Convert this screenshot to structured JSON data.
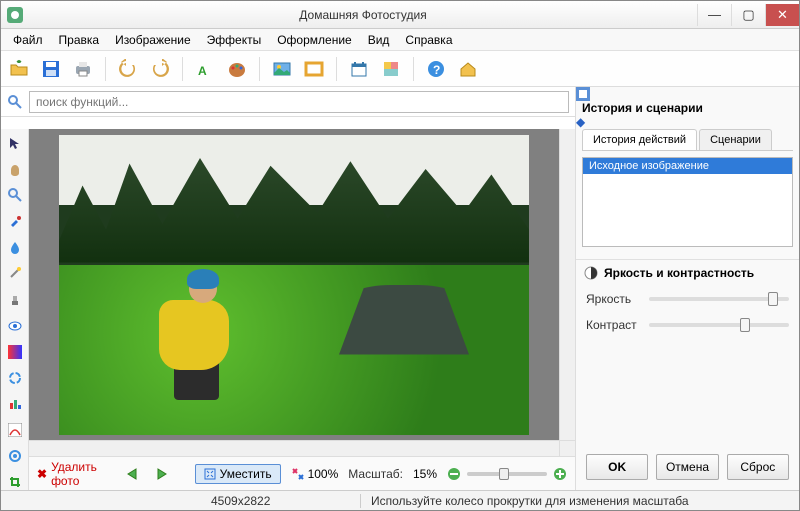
{
  "window": {
    "title": "Домашняя Фотостудия"
  },
  "menu": {
    "file": "Файл",
    "edit": "Правка",
    "image": "Изображение",
    "effects": "Эффекты",
    "design": "Оформление",
    "view": "Вид",
    "help": "Справка"
  },
  "search": {
    "placeholder": "поиск функций..."
  },
  "rightpanel": {
    "history_title": "История и сценарии",
    "tab_history": "История действий",
    "tab_scenarios": "Сценарии",
    "history_item0": "Исходное изображение",
    "bc_title": "Яркость и контрастность",
    "brightness_label": "Яркость",
    "contrast_label": "Контраст",
    "ok": "OK",
    "cancel": "Отмена",
    "reset": "Сброс"
  },
  "bottom": {
    "delete": "Удалить фото",
    "fit": "Уместить",
    "zoom100": "100%",
    "scale_label": "Масштаб:",
    "scale_value": "15%"
  },
  "status": {
    "dims": "4509x2822",
    "hint": "Используйте колесо прокрутки для изменения масштаба"
  }
}
